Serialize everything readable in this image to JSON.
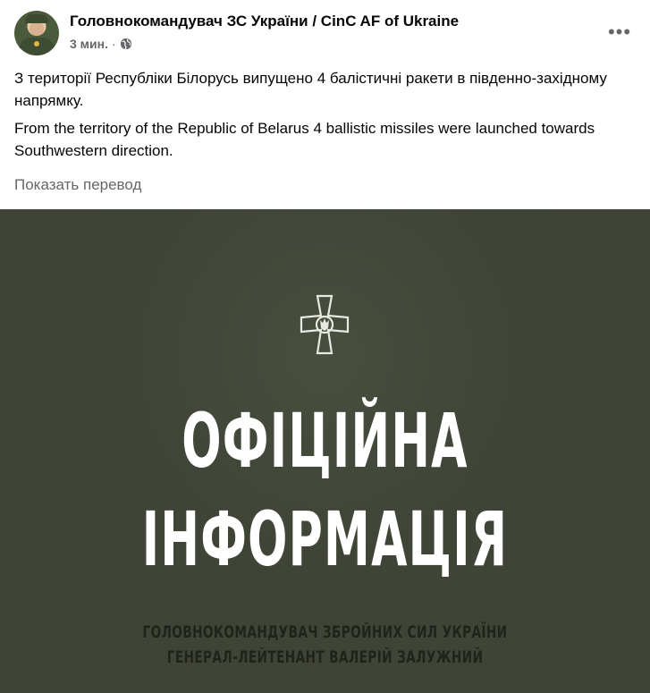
{
  "post": {
    "page_name": "Головнокомандувач ЗС України / CinC AF of Ukraine",
    "time": "3 мин.",
    "separator": "·",
    "privacy_icon": "globe-icon",
    "more_icon": "more-options-icon",
    "more_label": "•••",
    "text_uk": "З території Республіки Білорусь випущено 4 балістичні ракети в південно-західному напрямку.",
    "text_en": "From the territory of the Republic of Belarus 4 ballistic missiles were launched towards Southwestern direction.",
    "translate_label": "Показать перевод"
  },
  "image": {
    "headline_line1": "ОФІЦІЙНА",
    "headline_line2": "ІНФОРМАЦІЯ",
    "signature_line1": "ГОЛОВНОКОМАНДУВАЧ ЗБРОЙНИХ СИЛ УКРАЇНИ",
    "signature_line2": "ГЕНЕРАЛ-ЛЕЙТЕНАНТ ВАЛЕРІЙ ЗАЛУЖНИЙ",
    "emblem_icon": "armed-forces-cross-icon",
    "background_color": "#3f4437"
  }
}
